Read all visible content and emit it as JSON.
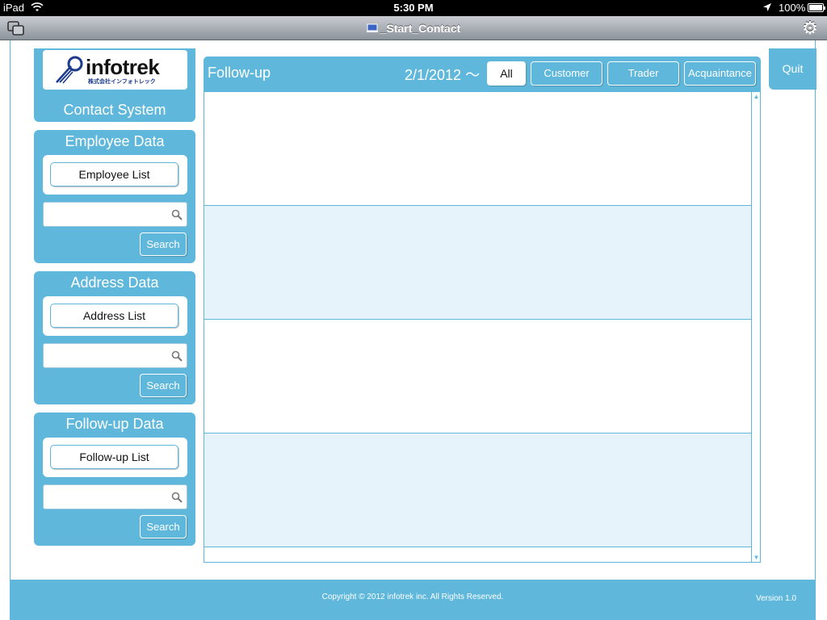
{
  "status_bar": {
    "carrier": "iPad",
    "time": "5:30 PM",
    "battery": "100%",
    "icons": [
      "wifi-icon",
      "location-icon",
      "battery-icon"
    ]
  },
  "title_bar": {
    "title": "_Start_Contact",
    "icons": [
      "windows-icon",
      "document-icon",
      "gear-icon"
    ]
  },
  "logo": {
    "name": "infotrek",
    "subtitle": "株式会社インフォトレック",
    "caption": "Contact System"
  },
  "panels": {
    "employee": {
      "title": "Employee Data",
      "list_label": "Employee List",
      "search_label": "Search",
      "search_value": ""
    },
    "address": {
      "title": "Address Data",
      "list_label": "Address List",
      "search_label": "Search",
      "search_value": ""
    },
    "followup": {
      "title": "Follow-up Data",
      "list_label": "Follow-up List",
      "search_label": "Search",
      "search_value": ""
    }
  },
  "main": {
    "title": "Follow-up",
    "date": "2/1/2012 ～",
    "filters": [
      "All",
      "Customer",
      "Trader",
      "Acquaintance"
    ],
    "active_filter": "All",
    "rows": [
      "",
      "",
      "",
      ""
    ]
  },
  "quit_label": "Quit",
  "footer": {
    "copyright": "Copyright © 2012 infotrek inc. All Rights Reserved.",
    "version": "Version 1.0"
  },
  "colors": {
    "accent": "#5fb8dc",
    "row_alt": "#e6f3fb",
    "status_bar": "#000000"
  }
}
